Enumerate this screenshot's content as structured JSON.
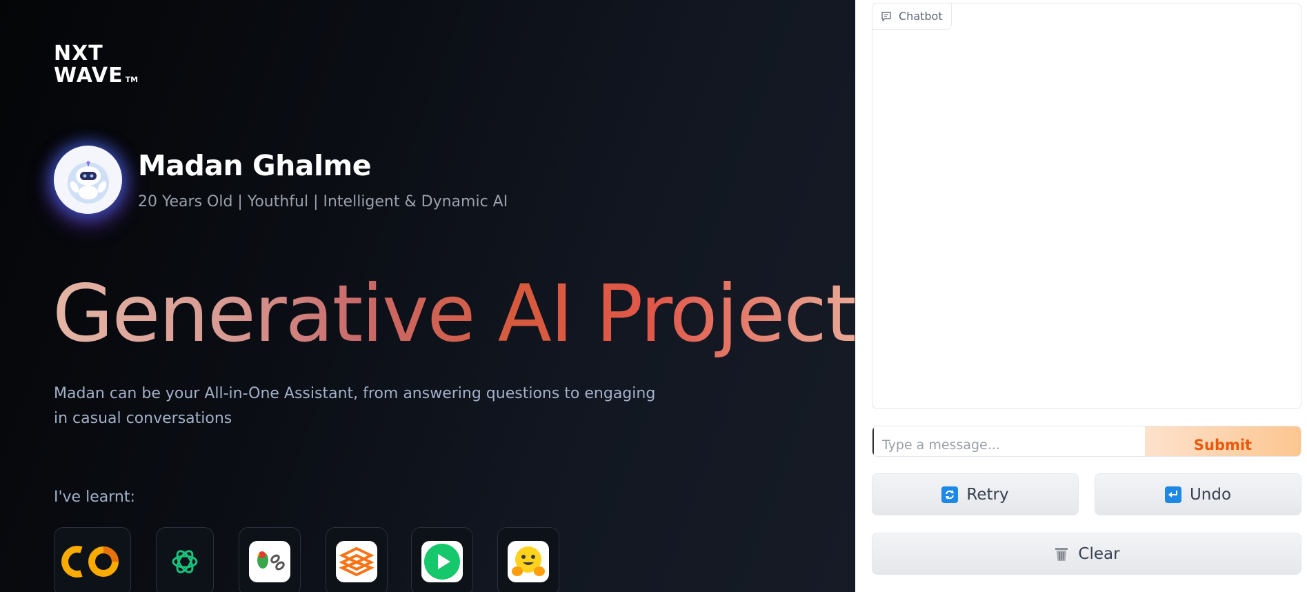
{
  "brand": {
    "line1": "NXT",
    "line2": "WAVE",
    "trademark": "TM"
  },
  "profile": {
    "name": "Madan Ghalme",
    "tagline": "20 Years Old | Youthful | Intelligent & Dynamic AI"
  },
  "hero": {
    "headline": "Generative AI Project",
    "description": "Madan can be your All-in-One Assistant, from answering questions to engaging in casual conversations",
    "learnt_label": "I've learnt:"
  },
  "tools": [
    {
      "icon": "colab-icon",
      "text": "CO"
    },
    {
      "icon": "openai-icon"
    },
    {
      "icon": "langchain-icon"
    },
    {
      "icon": "gradio-icon"
    },
    {
      "icon": "play-icon"
    },
    {
      "icon": "huggingface-icon"
    }
  ],
  "chat": {
    "chatbot_label": "Chatbot",
    "input_placeholder": "Type a message...",
    "submit_label": "Submit",
    "retry_label": "Retry",
    "undo_label": "Undo",
    "clear_label": "Clear"
  },
  "colors": {
    "submit_text": "#ea580c",
    "submit_bg_start": "#fde2cc",
    "submit_bg_end": "#fcc690",
    "headline_accent": "#d75a3d"
  }
}
